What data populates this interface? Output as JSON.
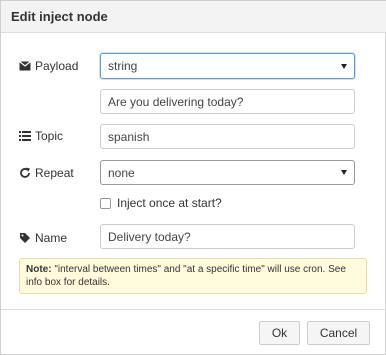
{
  "dialog": {
    "title": "Edit inject node"
  },
  "payload": {
    "label": "Payload",
    "icon": "envelope-icon",
    "type_value": "string",
    "value": "Are you delivering today?"
  },
  "topic": {
    "label": "Topic",
    "icon": "list-icon",
    "value": "spanish"
  },
  "repeat": {
    "label": "Repeat",
    "icon": "repeat-icon",
    "value": "none"
  },
  "inject_once": {
    "label": "Inject once at start?",
    "checked": false
  },
  "name": {
    "label": "Name",
    "icon": "tag-icon",
    "value": "Delivery today?"
  },
  "note": {
    "bold": "Note:",
    "text": "\"interval between times\" and \"at a specific time\" will use cron. See info box for details."
  },
  "buttons": {
    "ok": "Ok",
    "cancel": "Cancel"
  },
  "colors": {
    "focus_border": "#5b9bd5",
    "note_bg": "#fffbdc"
  }
}
